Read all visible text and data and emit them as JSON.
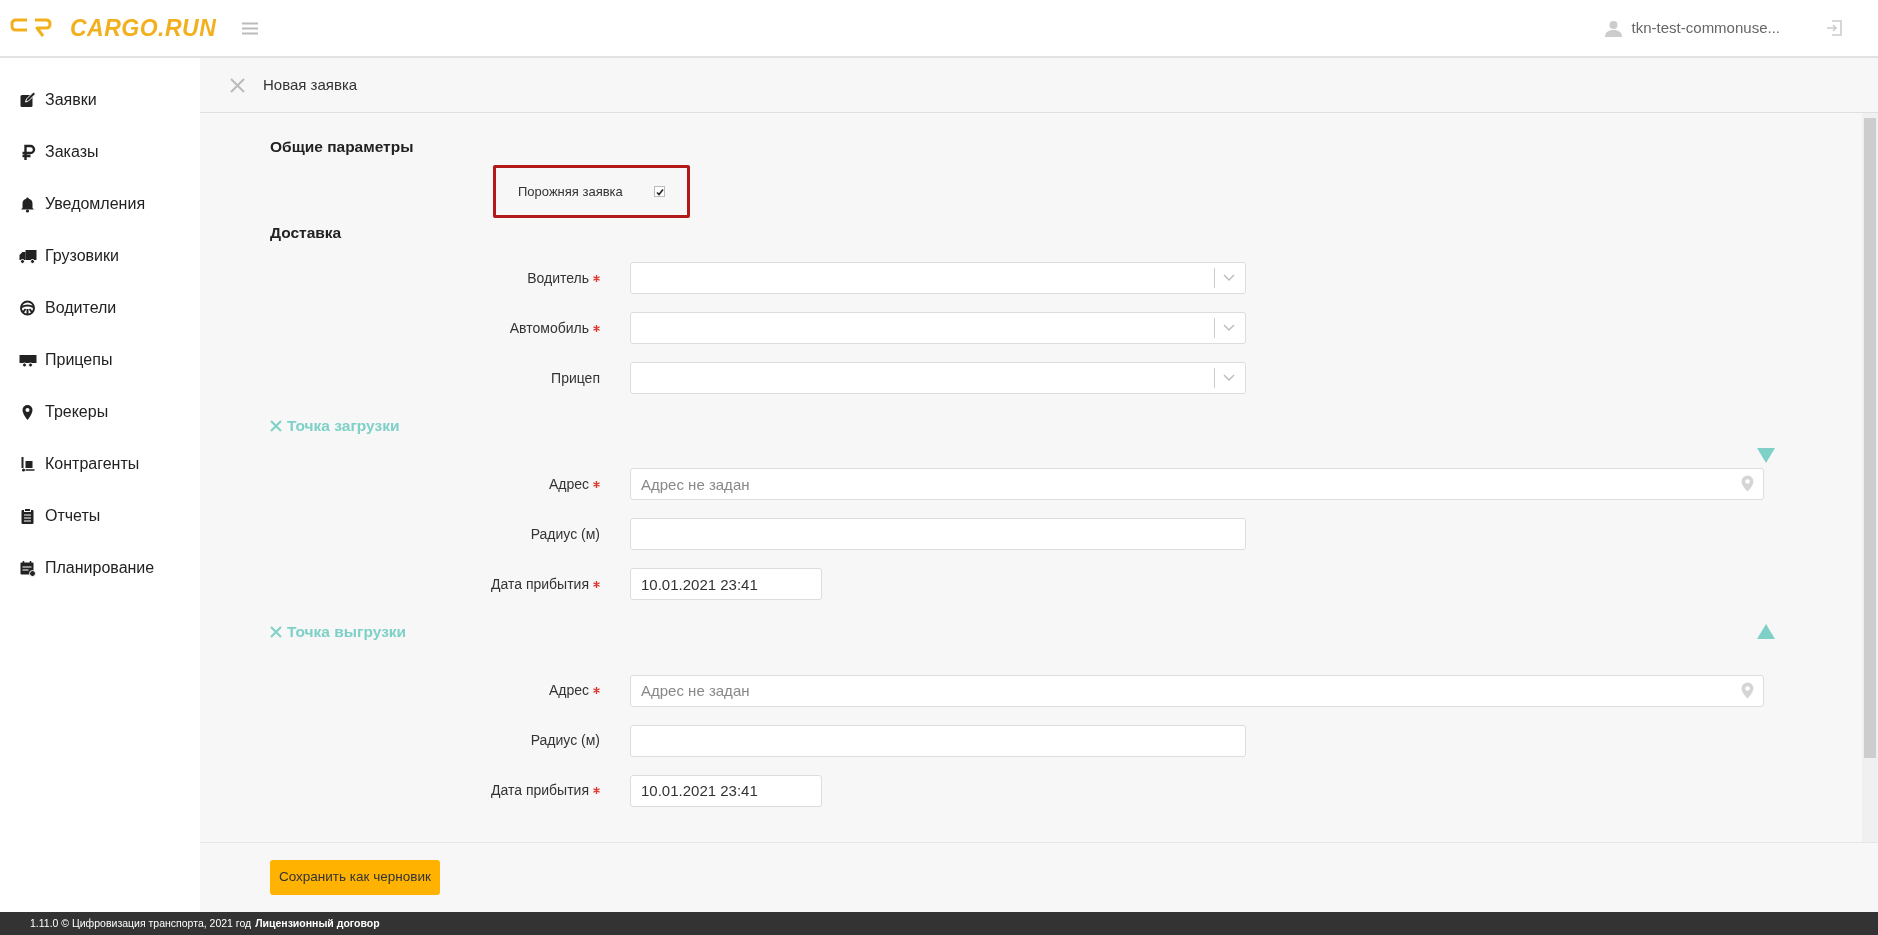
{
  "header": {
    "logo": "CARGO.RUN",
    "user": "tkn-test-commonuse..."
  },
  "sidebar": {
    "items": [
      {
        "label": "Заявки"
      },
      {
        "label": "Заказы"
      },
      {
        "label": "Уведомления"
      },
      {
        "label": "Грузовики"
      },
      {
        "label": "Водители"
      },
      {
        "label": "Прицепы"
      },
      {
        "label": "Трекеры"
      },
      {
        "label": "Контрагенты"
      },
      {
        "label": "Отчеты"
      },
      {
        "label": "Планирование"
      }
    ]
  },
  "page": {
    "title": "Новая заявка"
  },
  "general": {
    "heading": "Общие параметры",
    "empty_order": {
      "label": "Порожняя заявка",
      "checked": true,
      "highlighted": true
    }
  },
  "delivery": {
    "heading": "Доставка",
    "fields": [
      {
        "label": "Водитель",
        "required": true,
        "kind": "select"
      },
      {
        "label": "Автомобиль",
        "required": true,
        "kind": "select"
      },
      {
        "label": "Прицеп",
        "required": false,
        "kind": "select"
      }
    ]
  },
  "points": [
    {
      "heading": "Точка загрузки",
      "fields": [
        {
          "label": "Адрес",
          "required": true,
          "kind": "address",
          "placeholder": "Адрес не задан"
        },
        {
          "label": "Радиус (м)",
          "required": false,
          "kind": "text"
        },
        {
          "label": "Дата прибытия",
          "required": true,
          "kind": "date",
          "value": "10.01.2021 23:41"
        }
      ]
    },
    {
      "heading": "Точка выгрузки",
      "fields": [
        {
          "label": "Адрес",
          "required": true,
          "kind": "address",
          "placeholder": "Адрес не задан"
        },
        {
          "label": "Радиус (м)",
          "required": false,
          "kind": "text"
        },
        {
          "label": "Дата прибытия",
          "required": true,
          "kind": "date",
          "value": "10.01.2021 23:41"
        }
      ]
    }
  ],
  "actions": {
    "save_draft": "Сохранить как черновик"
  },
  "footer": {
    "text": "1.11.0 © Цифровизация транспорта, 2021 год",
    "link": "Лицензионный договор"
  }
}
